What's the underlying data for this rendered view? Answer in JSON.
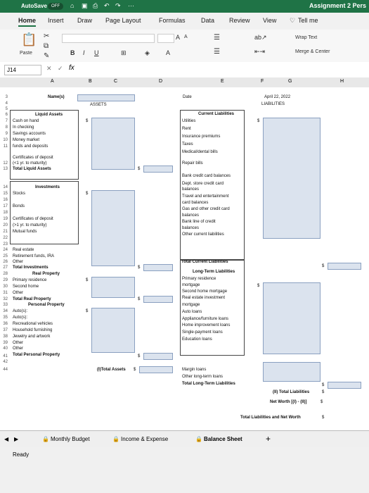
{
  "titlebar": {
    "autosave": "AutoSave",
    "toggle": "OFF",
    "doc_title": "Assignment 2 Pers",
    "more": "···"
  },
  "tabs": [
    "Home",
    "Insert",
    "Draw",
    "Page Layout",
    "Formulas",
    "Data",
    "Review",
    "View"
  ],
  "tell_me": "Tell me",
  "ribbon": {
    "paste": "Paste",
    "wrap_text": "Wrap Text",
    "merge_center": "Merge & Center",
    "font_grow": "A",
    "font_shrink": "A",
    "bold": "B",
    "italic": "I",
    "underline": "U"
  },
  "formula_bar": {
    "cell_ref": "J14",
    "fx": "fx"
  },
  "columns": [
    "A",
    "B",
    "C",
    "D",
    "E",
    "F",
    "G",
    "H"
  ],
  "rows": [
    "3",
    "4",
    "5",
    "6",
    "7",
    "8",
    "9",
    "10",
    "11",
    "",
    "12",
    "13",
    "",
    "14",
    "15",
    "16",
    "17",
    "18",
    "19",
    "20",
    "21",
    "22",
    "23",
    "24",
    "25",
    "26",
    "27",
    "28",
    "29",
    "30",
    "31",
    "32",
    "33",
    "34",
    "35",
    "36",
    "37",
    "38",
    "39",
    "40",
    "41",
    "42",
    "44"
  ],
  "left": {
    "name_label": "Name(s)",
    "assets": "ASSETS",
    "liquid_assets": "Liquid Assets",
    "cash_on_hand": "Cash on hand",
    "in_checking": "In checking",
    "savings": "Savings accounts",
    "money_market": "Money market",
    "funds_deposits": "funds and deposits",
    "cod1": "Certificates of deposit",
    "cod2": "(<1 yr. to maturity)",
    "total_liquid": "Total Liquid Assets",
    "investments": "Investments",
    "stocks": "Stocks",
    "bonds": "Bonds",
    "cod3": "Certificates of deposit",
    "cod4": "(>1 yr. to maturity)",
    "mutual": "Mutual funds",
    "real_estate": "Real estate",
    "retirement": "Retirement funds, IRA",
    "other": "Other",
    "total_investments": "Total Investments",
    "real_property": "Real Property",
    "primary": "Primary residence",
    "second_home": "Second home",
    "other2": "Other",
    "total_real_property": "Total Real Property",
    "personal_property": "Personal Property",
    "auto1": "Auto(s):",
    "auto2": "Auto(s):",
    "rec_vehicles": "Recreational vehicles",
    "household": "Household furnishing",
    "jewelry": "Jewelry and artwork",
    "other3": "Other",
    "other4": "Other",
    "total_personal": "Total Personal Property",
    "total_assets": "(I)Total Assets",
    "dollar": "$"
  },
  "right": {
    "date_label": "Date",
    "date_value": "April 22, 2022",
    "liabilities": "LIABILITIES",
    "current": "Current Liabilities",
    "utilities": "Utilities",
    "rent": "Rent",
    "insurance": "Insurance premiums",
    "taxes": "Taxes",
    "medical": "Medical/dental bills",
    "repair": "Repair bills",
    "bank_cc": "Bank credit card balances",
    "dept_store1": "Dept. store credit card",
    "dept_store2": "balances",
    "travel1": "Travel and entertainment",
    "travel2": "card balances",
    "gas1": "Gas and other credit card",
    "gas2": "balances",
    "bank_line1": "Bank line of credit",
    "bank_line2": "balances",
    "other_current": "Other current liabilities",
    "total_current": "Total Current Liabilities",
    "long_term": "Long-Term Liabilities",
    "primary1": "Primary residence",
    "primary2": "mortgage",
    "second1": "Second home mortgage",
    "real_estate1": "Real estate investment",
    "real_estate2": "mortgage",
    "auto_loans": "Auto loans",
    "appliance": "Appliance/furniture loans",
    "home_improvement": "Home improvement loans",
    "single_payment": "Single-payment loans",
    "education": "Education loans",
    "margin": "Margin loans",
    "other_long": "Other long-term loans",
    "total_long": "Total Long-Term Liabilities",
    "total_liabilities": "(II) Total Liabilities",
    "net_worth": "Net Worth [(I) - (II)]",
    "total_liab_nw": "Total Liabilities and Net Worth",
    "dollar": "$"
  },
  "sheet_tabs": [
    "Monthly Budget",
    "Income & Expense",
    "Balance Sheet"
  ],
  "add_sheet": "+",
  "status": "Ready",
  "colors": {
    "excel_green": "#1f7346",
    "input_fill": "#dbe3ee"
  }
}
